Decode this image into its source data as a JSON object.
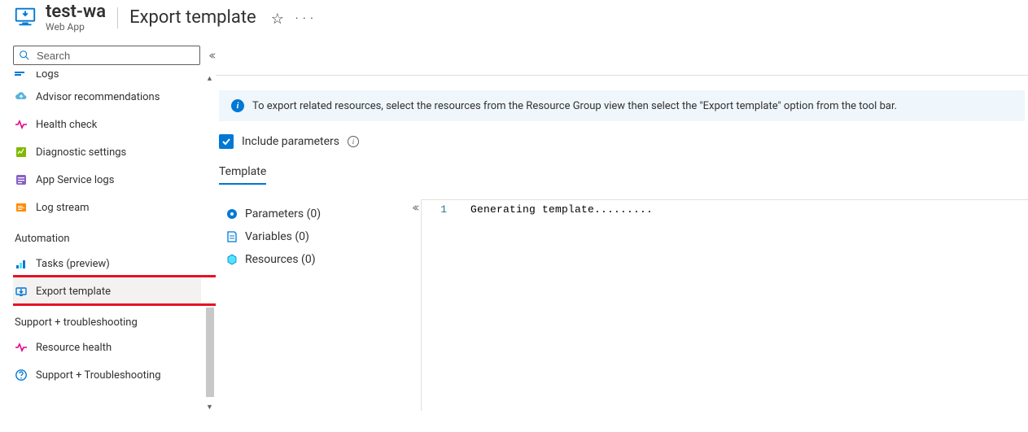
{
  "header": {
    "resource_name": "test-wa",
    "resource_type": "Web App",
    "page_title": "Export template"
  },
  "search": {
    "placeholder": "Search"
  },
  "sidebar": {
    "cut_item": "Logs",
    "items": [
      {
        "label": "Advisor recommendations",
        "icon": "cloud-arrow-icon",
        "color": "#59b4d9"
      },
      {
        "label": "Health check",
        "icon": "heartbeat-icon",
        "color": "#e3008c"
      },
      {
        "label": "Diagnostic settings",
        "icon": "diagnostics-icon",
        "color": "#7fba00"
      },
      {
        "label": "App Service logs",
        "icon": "app-logs-icon",
        "color": "#8661c5"
      },
      {
        "label": "Log stream",
        "icon": "log-stream-icon",
        "color": "#ff8c00"
      }
    ],
    "groups": [
      {
        "label": "Automation",
        "items": [
          {
            "label": "Tasks (preview)",
            "icon": "tasks-icon",
            "color": "#0078d4"
          },
          {
            "label": "Export template",
            "icon": "export-template-icon",
            "color": "#0078d4",
            "selected": true
          }
        ]
      },
      {
        "label": "Support + troubleshooting",
        "items": [
          {
            "label": "Resource health",
            "icon": "heartbeat-icon",
            "color": "#e3008c"
          },
          {
            "label": "Support + Troubleshooting",
            "icon": "help-circle-icon",
            "color": "#0078d4"
          }
        ]
      }
    ]
  },
  "main": {
    "info_text": "To export related resources, select the resources from the Resource Group view then select the \"Export template\" option from the tool bar.",
    "checkbox_label": "Include parameters",
    "checkbox_checked": true,
    "tab_label": "Template",
    "tree": {
      "parameters": {
        "label": "Parameters",
        "count": 0
      },
      "variables": {
        "label": "Variables",
        "count": 0
      },
      "resources": {
        "label": "Resources",
        "count": 0
      }
    },
    "editor": {
      "line_number": "1",
      "line_text": "Generating template........."
    }
  }
}
